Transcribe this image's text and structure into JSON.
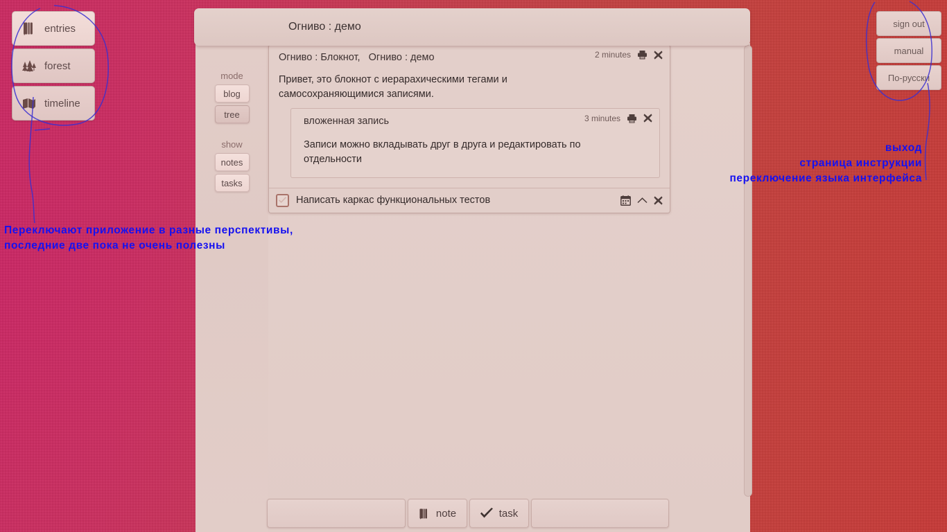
{
  "window": {
    "title": "Огниво : демо"
  },
  "left_nav": {
    "items": [
      {
        "label": "entries",
        "icon": "notebook-icon",
        "active": true
      },
      {
        "label": "forest",
        "icon": "trees-icon",
        "active": false
      },
      {
        "label": "timeline",
        "icon": "open-book-icon",
        "active": false
      }
    ]
  },
  "right_nav": {
    "items": [
      {
        "label": "sign out",
        "name": "sign-out-button"
      },
      {
        "label": "manual",
        "name": "manual-button"
      },
      {
        "label": "По-русски",
        "name": "language-button"
      }
    ]
  },
  "rail": {
    "mode_label": "mode",
    "mode_options": [
      {
        "label": "blog",
        "selected": true
      },
      {
        "label": "tree",
        "selected": false
      }
    ],
    "show_label": "show",
    "show_options": [
      {
        "label": "notes",
        "selected": true
      },
      {
        "label": "tasks",
        "selected": true
      }
    ]
  },
  "entries": {
    "root": {
      "tags": "Огниво : Блокнот,   Огниво : демо",
      "body": "Привет, это блокнот с иерарахическими тегами и самосохраняющимися записями.",
      "timestamp": "2 minutes",
      "print_icon": "printer-icon",
      "close_icon": "close-icon"
    },
    "nested": {
      "title": "вложенная запись",
      "body": "Записи можно вкладывать друг в друга и редактировать по отдельности",
      "timestamp": "3 minutes",
      "print_icon": "printer-icon",
      "close_icon": "close-icon"
    },
    "task": {
      "text": "Написать каркас функциональных тестов",
      "checked": false,
      "calendar_icon": "calendar-icon",
      "collapse_icon": "chevron-up-icon",
      "close_icon": "close-icon"
    }
  },
  "bottom_bar": {
    "note_label": "note",
    "note_icon": "notebook-icon",
    "task_label": "task",
    "task_icon": "check-icon"
  },
  "annotations": {
    "left": "Переключают приложение в разные перспективы,\nпоследние две пока не очень полезны",
    "left_line1": "Переключают приложение в разные перспективы,",
    "left_line2": "последние две пока не очень полезны",
    "right_line1": "выход",
    "right_line2": "страница инструкции",
    "right_line3": "переключение языка интерфейса",
    "color": "#1511f0"
  },
  "colors": {
    "background_left": "#c8325f",
    "background_right": "#c43c3a",
    "panel": "#e2cdc8",
    "titlebar": "#e4d1cc",
    "text": "#342a2a",
    "muted_text": "#8a6c6a",
    "annotation": "#1511f0",
    "checkbox_border": "#a9736a"
  }
}
